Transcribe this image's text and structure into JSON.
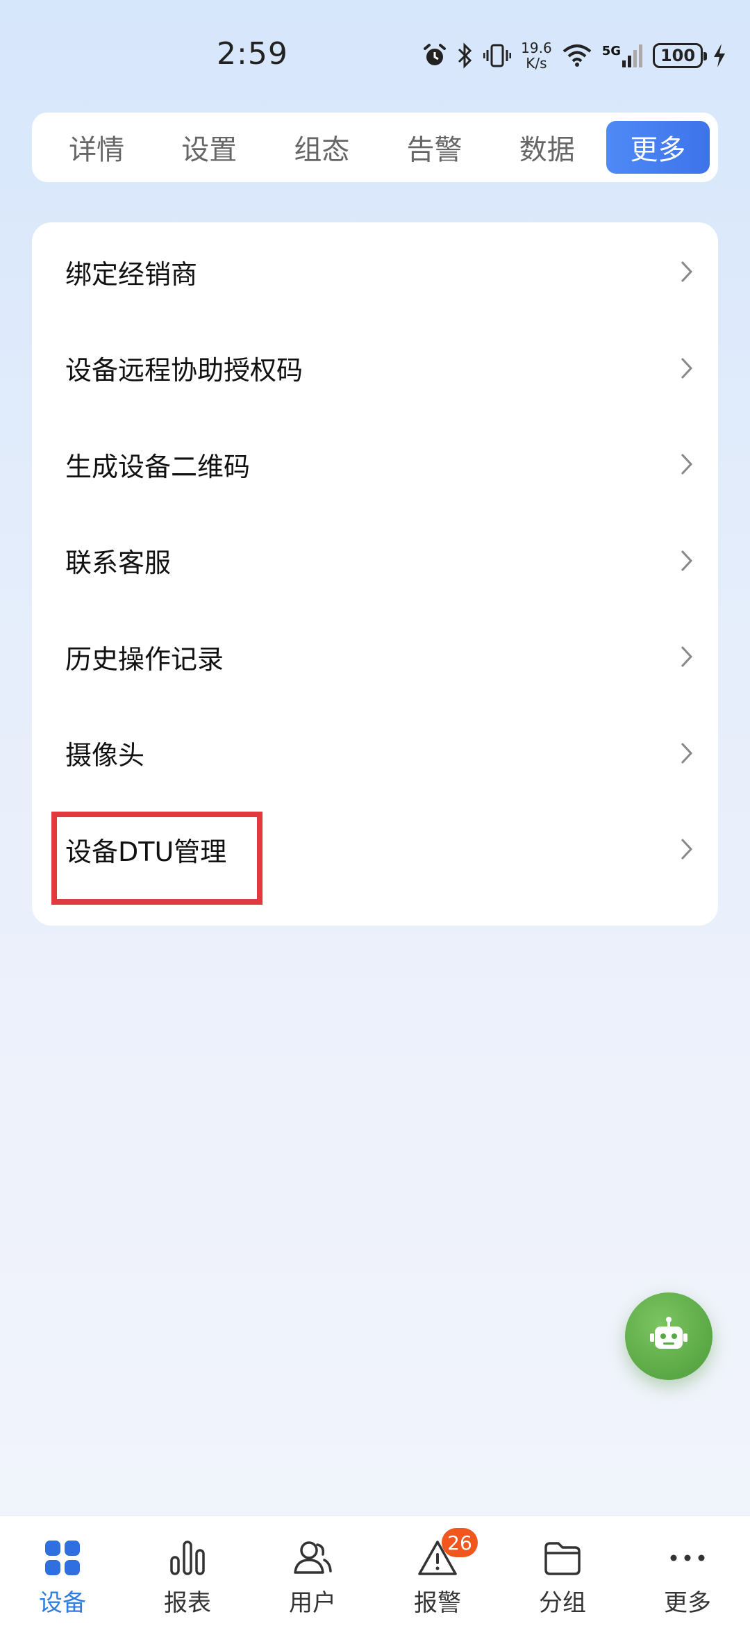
{
  "status_bar": {
    "time": "2:59",
    "net_speed_value": "19.6",
    "net_speed_unit": "K/s",
    "network_type": "5G",
    "battery": "100"
  },
  "tabs": [
    {
      "label": "详情",
      "active": false
    },
    {
      "label": "设置",
      "active": false
    },
    {
      "label": "组态",
      "active": false
    },
    {
      "label": "告警",
      "active": false
    },
    {
      "label": "数据",
      "active": false
    },
    {
      "label": "更多",
      "active": true
    }
  ],
  "menu": {
    "items": [
      {
        "label": "绑定经销商"
      },
      {
        "label": "设备远程协助授权码"
      },
      {
        "label": "生成设备二维码"
      },
      {
        "label": "联系客服"
      },
      {
        "label": "历史操作记录"
      },
      {
        "label": "摄像头"
      },
      {
        "label": "设备DTU管理"
      }
    ],
    "highlighted_item": "设备DTU管理"
  },
  "fab": {
    "icon": "robot-icon",
    "color": "#5aa845"
  },
  "bottom_nav": {
    "items": [
      {
        "label": "设备",
        "icon": "grid-icon",
        "active": true
      },
      {
        "label": "报表",
        "icon": "bar-chart-icon",
        "active": false
      },
      {
        "label": "用户",
        "icon": "users-icon",
        "active": false
      },
      {
        "label": "报警",
        "icon": "warning-icon",
        "active": false,
        "badge": "26"
      },
      {
        "label": "分组",
        "icon": "folder-icon",
        "active": false
      },
      {
        "label": "更多",
        "icon": "more-icon",
        "active": false
      }
    ]
  },
  "colors": {
    "accent": "#3e73ea",
    "nav_active": "#2f7de0",
    "highlight": "#e03a3e",
    "badge": "#f0561e"
  }
}
